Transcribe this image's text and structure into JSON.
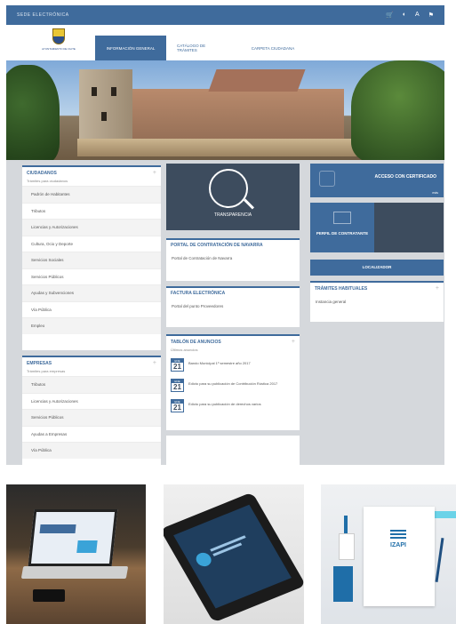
{
  "topbar": {
    "brand": "SEDE ELECTRÓNICA",
    "tools": [
      {
        "icon": "cart-icon",
        "glyph": "🛒"
      },
      {
        "icon": "contrast-icon",
        "glyph": "◐"
      },
      {
        "icon": "text-size-icon",
        "glyph": "A"
      },
      {
        "icon": "flag-icon",
        "glyph": "⚑"
      }
    ]
  },
  "header": {
    "logo_text": "AYUNTAMIENTO DE OLITE",
    "nav": [
      {
        "label": "INFORMACIÓN GENERAL",
        "active": true
      },
      {
        "label": "CATÁLOGO DE TRÁMITES",
        "active": false
      },
      {
        "label": "CARPETA CIUDADANA",
        "active": false
      }
    ]
  },
  "ciudadanos": {
    "title": "CIUDADANOS",
    "subtitle": "Trámites para ciudadanos",
    "items": [
      "Padrón de Habitantes",
      "Tributos",
      "Licencias y Autorizaciones",
      "Cultura, Ocio y Deporte",
      "Servicios Sociales",
      "Servicios Públicos",
      "Ayudas y Subvenciones",
      "Vía Pública",
      "Empleo"
    ]
  },
  "empresas": {
    "title": "EMPRESAS",
    "subtitle": "Trámites para empresas",
    "items": [
      "Tributos",
      "Licencias y Autorizaciones",
      "Servicios Públicos",
      "Ayudas a Empresas",
      "Vía Pública"
    ]
  },
  "transparencia": {
    "label": "TRANSPARENCIA"
  },
  "portal_contratacion": {
    "title": "PORTAL DE CONTRATACIÓN DE NAVARRA",
    "link": "Portal de Contratación de Navarra"
  },
  "factura": {
    "title": "FACTURA ELECTRÓNICA",
    "link": "Portal del punto Proveedores"
  },
  "tablon": {
    "title": "TABLÓN DE ANUNCIOS",
    "subtitle": "Últimos anuncios",
    "items": [
      {
        "month": "ENE",
        "day": "21",
        "text": "Bando Municipal 1º semestre año 2017"
      },
      {
        "month": "ENE",
        "day": "21",
        "text": "Edicto para su publicación de Contribución Rústica 2017"
      },
      {
        "month": "ENE",
        "day": "21",
        "text": "Edicto para su publicación de derechos varios"
      }
    ]
  },
  "acceso": {
    "label": "ACCESO CON CERTIFICADO",
    "sub": "más"
  },
  "perfil": {
    "label": "PERFIL DE CONTRATANTE"
  },
  "localizadores": {
    "label": "LOCALIZADOR"
  },
  "tramites": {
    "title": "TRÁMITES HABITUALES",
    "link": "Instancia general"
  },
  "colors": {
    "accent": "#3f6b9c",
    "dark": "#3d4c5e"
  }
}
